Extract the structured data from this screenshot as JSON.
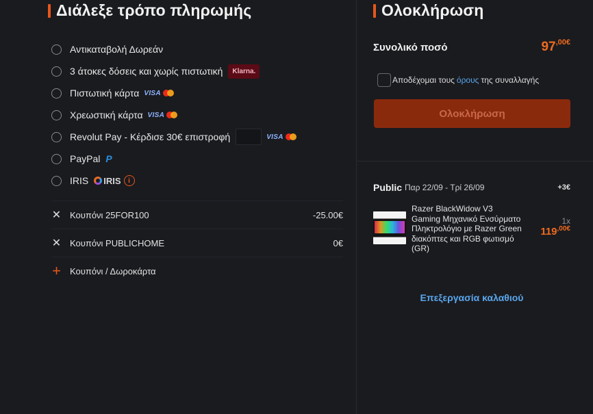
{
  "payment": {
    "title": "Διάλεξε τρόπο πληρωμής",
    "methods": [
      {
        "label": "Αντικαταβολή Δωρεάν"
      },
      {
        "label": "3 άτοκες δόσεις και χωρίς πιστωτική",
        "badge": "Klarna."
      },
      {
        "label": "Πιστωτική κάρτα",
        "card": "VISA"
      },
      {
        "label": "Χρεωστική κάρτα",
        "card": "VISA"
      },
      {
        "label": "Revolut Pay - Κέρδισε 30€ επιστροφή",
        "card": "VISA"
      },
      {
        "label": "PayPal",
        "logo": "P"
      },
      {
        "label": "IRIS",
        "logo": "IRIS",
        "info": "i"
      }
    ]
  },
  "coupons": [
    {
      "label": "Κουπόνι 25FOR100",
      "value": "-25.00€"
    },
    {
      "label": "Κουπόνι PUBLICHOME",
      "value": "0€"
    }
  ],
  "add_coupon": {
    "label": "Κουπόνι / Δωροκάρτα"
  },
  "summary": {
    "title": "Ολοκλήρωση",
    "total_label": "Συνολικό ποσό",
    "total_int": "97",
    "total_dec": ",00€",
    "terms_prefix": "Αποδέχομαι τους",
    "terms_link": "όρους",
    "terms_suffix": "της συναλλαγής",
    "button_label": "Ολοκλήρωση"
  },
  "delivery": {
    "store": "Public",
    "dates": "Παρ 22/09 - Τρί 26/09",
    "fee": "+3€"
  },
  "product": {
    "name": "Razer BlackWidow V3 Gaming Μηχανικό Ενσύρματο Πληκτρολόγιο με Razer Green διακόπτες και RGB φωτισμό (GR)",
    "qty": "1x",
    "price_int": "119",
    "price_dec": ",00€"
  },
  "edit_cart": "Επεξεργασία καλαθιού",
  "colors": {
    "accent": "#e8561b",
    "price": "#f06a1e",
    "link": "#5aa6ec",
    "button_bg": "#8a2a0c"
  }
}
